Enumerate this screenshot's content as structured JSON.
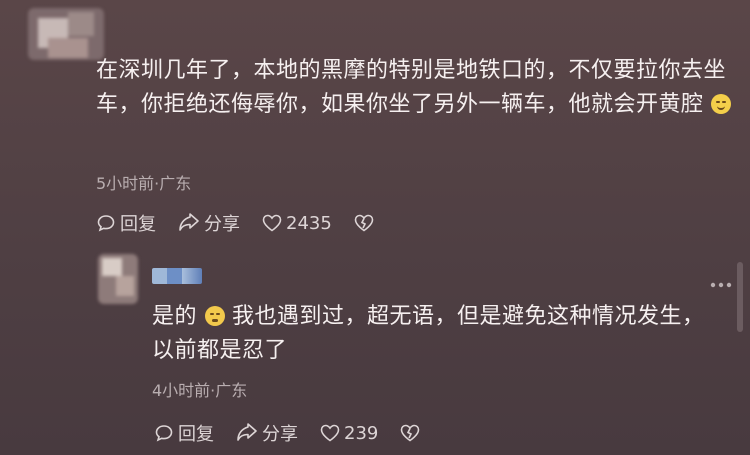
{
  "comments": [
    {
      "text": "在深圳几年了，本地的黑摩的特别是地铁口的，不仅要拉你去坐车，你拒绝还侮辱你，如果你坐了另外一辆车，他就会开黄腔",
      "emoji_icon": "smile-emoji",
      "meta": "5小时前·广东",
      "reply_label": "回复",
      "share_label": "分享",
      "like_count": "2435"
    },
    {
      "text_part1": "是的",
      "text_part2": "我也遇到过，超无语，但是避免这种情况发生，以前都是忍了",
      "emoji_icon": "flushed-emoji",
      "meta": "4小时前·广东",
      "reply_label": "回复",
      "share_label": "分享",
      "like_count": "239"
    }
  ],
  "colors": {
    "background": "#524144",
    "text": "#f6f0f0",
    "meta": "#b9aeb0",
    "username_blur": "#6d8fc6"
  },
  "icons": [
    "reply-icon",
    "share-icon",
    "heart-icon",
    "dislike-icon",
    "more-icon"
  ]
}
